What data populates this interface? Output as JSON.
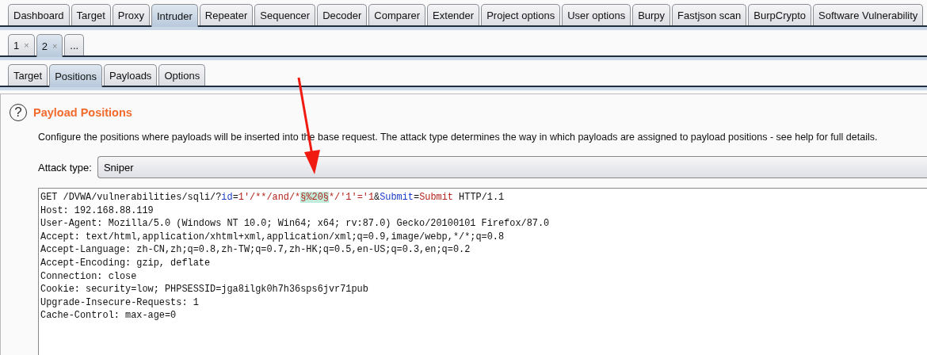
{
  "main_tabs": [
    {
      "label": "Dashboard",
      "selected": false
    },
    {
      "label": "Target",
      "selected": false
    },
    {
      "label": "Proxy",
      "selected": false
    },
    {
      "label": "Intruder",
      "selected": true
    },
    {
      "label": "Repeater",
      "selected": false
    },
    {
      "label": "Sequencer",
      "selected": false
    },
    {
      "label": "Decoder",
      "selected": false
    },
    {
      "label": "Comparer",
      "selected": false
    },
    {
      "label": "Extender",
      "selected": false
    },
    {
      "label": "Project options",
      "selected": false
    },
    {
      "label": "User options",
      "selected": false
    },
    {
      "label": "Burpy",
      "selected": false
    },
    {
      "label": "Fastjson scan",
      "selected": false
    },
    {
      "label": "BurpCrypto",
      "selected": false
    },
    {
      "label": "Software Vulnerability",
      "selected": false
    }
  ],
  "attack_tabs": [
    {
      "label": "1",
      "close": "×",
      "selected": false
    },
    {
      "label": "2",
      "close": "×",
      "selected": true
    },
    {
      "label": "...",
      "selected": false
    }
  ],
  "sub_tabs": [
    {
      "label": "Target",
      "selected": false
    },
    {
      "label": "Positions",
      "selected": true
    },
    {
      "label": "Payloads",
      "selected": false
    },
    {
      "label": "Options",
      "selected": false
    }
  ],
  "section": {
    "help": "?",
    "title": "Payload Positions",
    "description": "Configure the positions where payloads will be inserted into the base request. The attack type determines the way in which payloads are assigned to payload positions - see help for full details."
  },
  "attack_type": {
    "label": "Attack type:",
    "value": "Sniper"
  },
  "request": {
    "first_line": [
      {
        "kind": "plain",
        "text": "GET /DVWA/vulnerabilities/sqli/?"
      },
      {
        "kind": "param",
        "text": "id"
      },
      {
        "kind": "plain",
        "text": "="
      },
      {
        "kind": "value",
        "text": "1'/**/and/*"
      },
      {
        "kind": "marker",
        "text": "§%20§"
      },
      {
        "kind": "value",
        "text": "*/'1'='1"
      },
      {
        "kind": "plain",
        "text": "&"
      },
      {
        "kind": "param",
        "text": "Submit"
      },
      {
        "kind": "plain",
        "text": "="
      },
      {
        "kind": "value",
        "text": "Submit"
      },
      {
        "kind": "plain",
        "text": " HTTP/1.1"
      }
    ],
    "lines": [
      "Host: 192.168.88.119",
      "User-Agent: Mozilla/5.0 (Windows NT 10.0; Win64; x64; rv:87.0) Gecko/20100101 Firefox/87.0",
      "Accept: text/html,application/xhtml+xml,application/xml;q=0.9,image/webp,*/*;q=0.8",
      "Accept-Language: zh-CN,zh;q=0.8,zh-TW;q=0.7,zh-HK;q=0.5,en-US;q=0.3,en;q=0.2",
      "Accept-Encoding: gzip, deflate",
      "Connection: close",
      "Cookie: security=low; PHPSESSID=jga8ilgk0h7h36sps6jvr71pub",
      "Upgrade-Insecure-Requests: 1",
      "Cache-Control: max-age=0"
    ]
  }
}
